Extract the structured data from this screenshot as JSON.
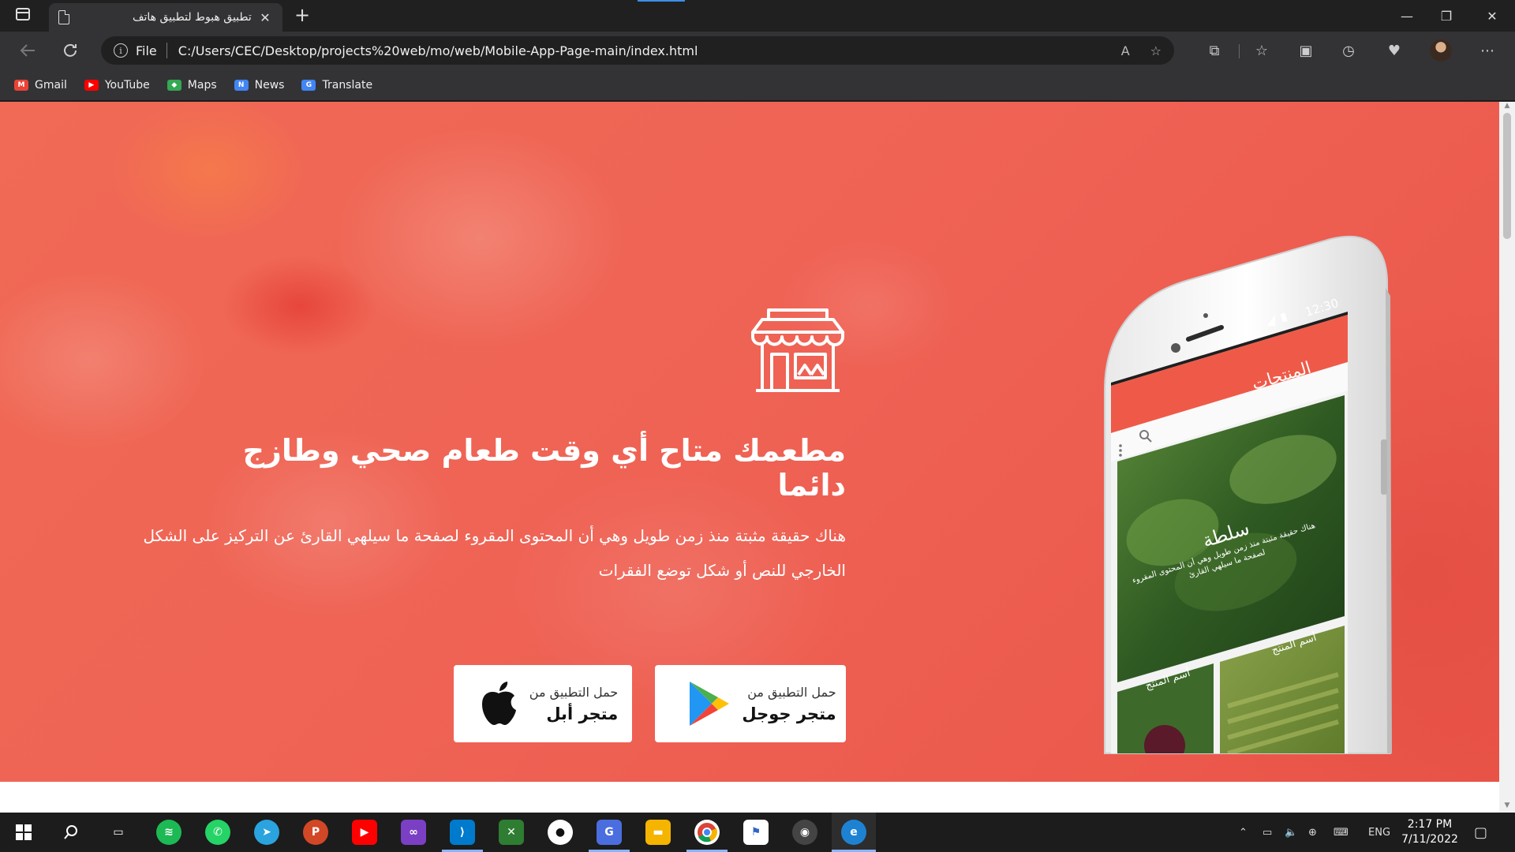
{
  "browser": {
    "tab_title": "تطبيق هبوط لتطبيق هاتف",
    "tab_close": "✕",
    "new_tab": "+",
    "scheme": "File",
    "url": "C:/Users/CEC/Desktop/projects%20web/mo/web/Mobile-App-Page-main/index.html",
    "window_controls": {
      "minimize": "—",
      "restore": "❐",
      "close": "✕"
    }
  },
  "bookmarks": [
    {
      "label": "Gmail",
      "icon": "gmail-icon",
      "color": "#ea4335"
    },
    {
      "label": "YouTube",
      "icon": "youtube-icon",
      "color": "#ff0000"
    },
    {
      "label": "Maps",
      "icon": "maps-icon",
      "color": "#34a853"
    },
    {
      "label": "News",
      "icon": "news-icon",
      "color": "#4285f4"
    },
    {
      "label": "Translate",
      "icon": "translate-icon",
      "color": "#4285f4"
    }
  ],
  "hero": {
    "title": "مطعمك متاح أي وقت طعام صحي وطازج دائما",
    "description": "هناك حقيقة مثبتة منذ زمن طويل وهي أن المحتوى المقروء لصفحة ما سيلهي القارئ عن التركيز على الشكل الخارجي للنص أو شكل توضع الفقرات",
    "accent_color": "#ef6355",
    "google_button": {
      "small": "حمل التطبيق من",
      "big": "متجر جوجل"
    },
    "apple_button": {
      "small": "حمل التطبيق من",
      "big": "متجر أبل"
    }
  },
  "phone": {
    "time": "12:30",
    "header_title": "المنتجات",
    "card_title": "سلطة",
    "card_text": "هناك حقيقة مثبتة منذ زمن طويل وهي أن المحتوى المقروء لصفحة ما سيلهي القارئ",
    "product_left": "أسم المنتج",
    "product_right": "أسم المنتج"
  },
  "taskbar": {
    "language": "ENG",
    "time": "2:17 PM",
    "date": "7/11/2022"
  }
}
